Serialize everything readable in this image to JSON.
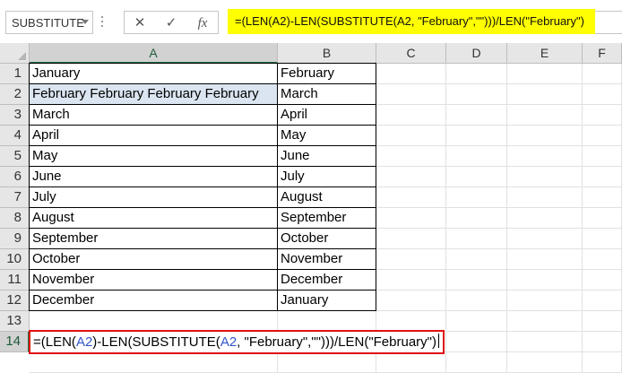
{
  "name_box": {
    "value": "SUBSTITUTE"
  },
  "formula_toolbar": {
    "cancel_glyph": "✕",
    "enter_glyph": "✓",
    "fx_glyph": "fx"
  },
  "formula_bar": {
    "text": "=(LEN(A2)-LEN(SUBSTITUTE(A2, \"February\",\"\")))/LEN(\"February\")",
    "highlight_color": "#ffff00"
  },
  "columns": [
    "A",
    "B",
    "C",
    "D",
    "E",
    "F"
  ],
  "rows": [
    "1",
    "2",
    "3",
    "4",
    "5",
    "6",
    "7",
    "8",
    "9",
    "10",
    "11",
    "12",
    "13",
    "14"
  ],
  "active_row": "14",
  "active_column": "A",
  "cells": {
    "a": [
      "January",
      "February February February February",
      "March",
      "April",
      "May",
      "June",
      "July",
      "August",
      "September",
      "October",
      "November",
      "December"
    ],
    "b": [
      "February",
      "March",
      "April",
      "May",
      "June",
      "July",
      "August",
      "September",
      "October",
      "November",
      "December",
      "January"
    ]
  },
  "highlighted_cell": "A2",
  "editing_cell": {
    "ref": "A14",
    "parts": [
      {
        "text": "=(LEN(",
        "color": "#000000"
      },
      {
        "text": "A2",
        "color": "#3355cc"
      },
      {
        "text": ")-LEN(",
        "color": "#000000"
      },
      {
        "text": "SUBSTITUTE(",
        "color": "#000000"
      },
      {
        "text": "A2",
        "color": "#3355cc"
      },
      {
        "text": ", \"February\",\"\")))/LEN(\"February\")",
        "color": "#000000"
      }
    ],
    "border_color": "#e01010"
  }
}
